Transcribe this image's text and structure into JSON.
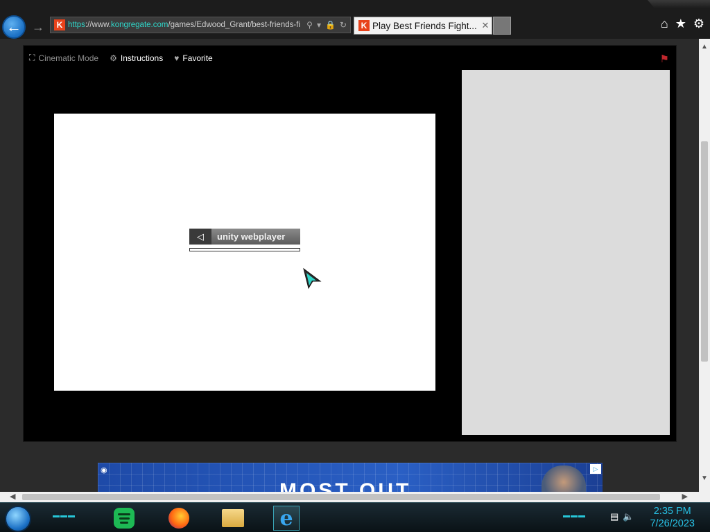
{
  "browser": {
    "address": {
      "scheme": "https",
      "pre_domain": "://www.",
      "domain": "kongregate.com",
      "path": "/games/Edwood_Grant/best-friends-fi"
    },
    "tab": {
      "title": "Play Best Friends Fight...",
      "favicon_letter": "K"
    }
  },
  "game_toolbar": {
    "cinematic": "Cinematic Mode",
    "instructions": "Instructions",
    "favorite": "Favorite"
  },
  "game": {
    "loader_text": "unity webplayer",
    "load_progress": 0
  },
  "banner": {
    "text": "MOST OUT"
  },
  "taskbar": {
    "time": "2:35 PM",
    "date": "7/26/2023"
  },
  "colors": {
    "accent": "#2fd5c8",
    "brand_kongregate": "#e8431b",
    "clock": "#28c2e6"
  }
}
